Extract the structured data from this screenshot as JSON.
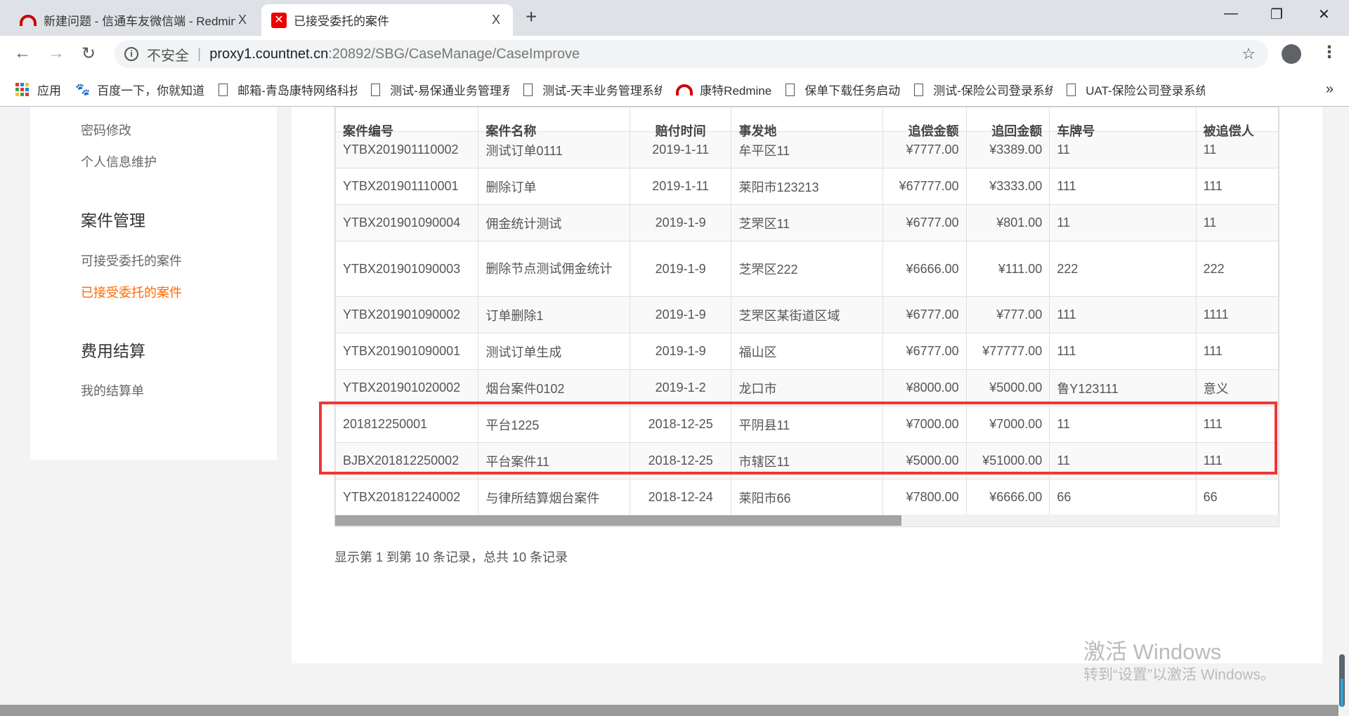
{
  "browser": {
    "tabs": [
      {
        "title": "新建问题 - 信通车友微信端 - Redmine",
        "icon": "redmine-icon",
        "active": false
      },
      {
        "title": "已接受委托的案件",
        "icon": "site-favicon",
        "active": true
      }
    ],
    "new_tab": "+",
    "close_glyph": "X",
    "url": {
      "security": "不安全",
      "host": "proxy1.countnet.cn",
      "path": ":20892/SBG/CaseManage/CaseImprove"
    },
    "bookmarks": [
      "应用",
      "百度一下，你就知道",
      "邮箱-青岛康特网络科技",
      "测试-易保通业务管理系统",
      "测试-天丰业务管理系统",
      "康特Redmine",
      "保单下载任务启动",
      "测试-保险公司登录系统",
      "UAT-保险公司登录系统"
    ],
    "bookmarks_more": "»"
  },
  "sidebar": {
    "items_top": [
      "密码修改",
      "个人信息维护"
    ],
    "sections": [
      {
        "title": "案件管理",
        "items": [
          "可接受委托的案件",
          "已接受委托的案件"
        ]
      },
      {
        "title": "费用结算",
        "items": [
          "我的结算单"
        ]
      }
    ],
    "active": "已接受委托的案件",
    "accent": "#ff6a00"
  },
  "table": {
    "headers": [
      "案件编号",
      "案件名称",
      "赔付时间",
      "事发地",
      "追偿金额",
      "追回金额",
      "车牌号",
      "被追偿人"
    ],
    "rows": [
      [
        "YTBX201901110002",
        "测试订单0111",
        "2019-1-11",
        "牟平区11",
        "¥7777.00",
        "¥3389.00",
        "11",
        "11"
      ],
      [
        "YTBX201901110001",
        "删除订单",
        "2019-1-11",
        "莱阳市123213",
        "¥67777.00",
        "¥3333.00",
        "111",
        "111"
      ],
      [
        "YTBX201901090004",
        "佣金统计测试",
        "2019-1-9",
        "芝罘区11",
        "¥6777.00",
        "¥801.00",
        "11",
        "11"
      ],
      [
        "YTBX201901090003",
        "删除节点测试佣金统计",
        "2019-1-9",
        "芝罘区222",
        "¥6666.00",
        "¥111.00",
        "222",
        "222"
      ],
      [
        "YTBX201901090002",
        "订单删除1",
        "2019-1-9",
        "芝罘区某街道区域",
        "¥6777.00",
        "¥777.00",
        "111",
        "1111"
      ],
      [
        "YTBX201901090001",
        "测试订单生成",
        "2019-1-9",
        "福山区",
        "¥6777.00",
        "¥77777.00",
        "111",
        "111"
      ],
      [
        "YTBX201901020002",
        "烟台案件0102",
        "2019-1-2",
        "龙口市",
        "¥8000.00",
        "¥5000.00",
        "鲁Y123111",
        "意义"
      ],
      [
        "201812250001",
        "平台1225",
        "2018-12-25",
        "平阴县11",
        "¥7000.00",
        "¥7000.00",
        "11",
        "111"
      ],
      [
        "BJBX201812250002",
        "平台案件11",
        "2018-12-25",
        "市辖区11",
        "¥5000.00",
        "¥51000.00",
        "11",
        "111"
      ],
      [
        "YTBX201812240002",
        "与律所结算烟台案件",
        "2018-12-24",
        "莱阳市66",
        "¥7800.00",
        "¥6666.00",
        "66",
        "66"
      ]
    ],
    "highlighted_rows": [
      7,
      8
    ],
    "highlight_color": "#f03636",
    "scroll_fraction": 0.6,
    "footer": "显示第 1 到第 10 条记录，总共 10 条记录"
  },
  "watermark": {
    "line1": "激活 Windows",
    "line2": "转到“设置”以激活 Windows。"
  }
}
